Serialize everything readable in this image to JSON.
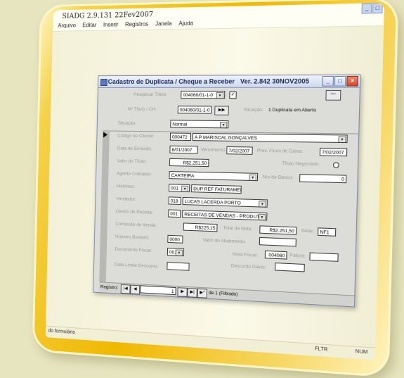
{
  "app": {
    "title": "SIADG 2.9.131 22Fev2007",
    "window_buttons": [
      "_",
      "□"
    ],
    "menu": [
      "Arquivo",
      "Editar",
      "Inserir",
      "Registros",
      "Janela",
      "Ajuda"
    ],
    "status_left": "do formulário",
    "status_mid": "FLTR",
    "status_right": "NUM"
  },
  "form": {
    "title": "Cadastro de Duplicata / Cheque a Receber",
    "version": "Ver. 2.842 30NOV2005",
    "search_label": "Pesquisar Título:",
    "search_value": "004060/01-1-0",
    "search_checked": "✓",
    "binoculars": "👓",
    "titulo_label": "Nº Título / CH:",
    "titulo_value": "004060/01-1-0",
    "titulo_button": "▶▶",
    "situacao_label_top": "Situação:",
    "situacao_status": "1 Duplicata em Aberto",
    "situacao_label": "Situação:",
    "situacao_value": "Normal",
    "cliente_label": "Código do Cliente:",
    "cliente_code": "000472",
    "cliente_name": "A P MARISCAL GONÇALVES",
    "emissao_label": "Data de Emissão:",
    "emissao_value": "8/01/2007",
    "vencimento_label": "Vencimento:",
    "vencimento_value": "7/02/2007",
    "prev_label": "Prev. Fluxo de Caixa:",
    "prev_value": "7/02/2007",
    "negociado_label": "Título Negociado:",
    "valor_label": "Valor do Título:",
    "valor_value": "R$2.251,50",
    "agente_label": "Agente Cobrador:",
    "agente_value": "CARTEIRA",
    "nro_banco_label": "Nro do Banco:",
    "nro_banco_value": "0",
    "historico_label": "Histórico:",
    "historico_code": "001",
    "historico_text": "DUP REF FATURAMENTO",
    "vendedor_label": "Vendedor:",
    "vendedor_code": "018",
    "vendedor_name": "LUCAS LACERDA PORTO",
    "centro_label": "Centro de Receita:",
    "centro_code": "001",
    "centro_name": "RECEITAS DE VENDAS - PRODUTOS",
    "comissao_label": "Comissão de Venda:",
    "comissao_value": "R$225,15",
    "total_nota_label": "Total da Nota:",
    "total_nota_value": "R$2.251,50",
    "serie_label": "Série:",
    "serie_value": "NF1",
    "bordero_label": "Número Borderô:",
    "bordero_value": "0000",
    "abatimento_label": "Valor do Abatimento:",
    "documento_label": "Documento Fiscal:",
    "documento_value": "001",
    "nota_fiscal_label": "Nota Fiscal:",
    "nota_fiscal_value": "004060",
    "fatura_label": "Fatura:",
    "desconto_diario_label": "Desconto Diário:",
    "data_limite_label": "Data Limite Desconto:",
    "registro_label": "Registro:",
    "registro_value": "1",
    "registro_total": "de 1 (Filtrado)"
  }
}
